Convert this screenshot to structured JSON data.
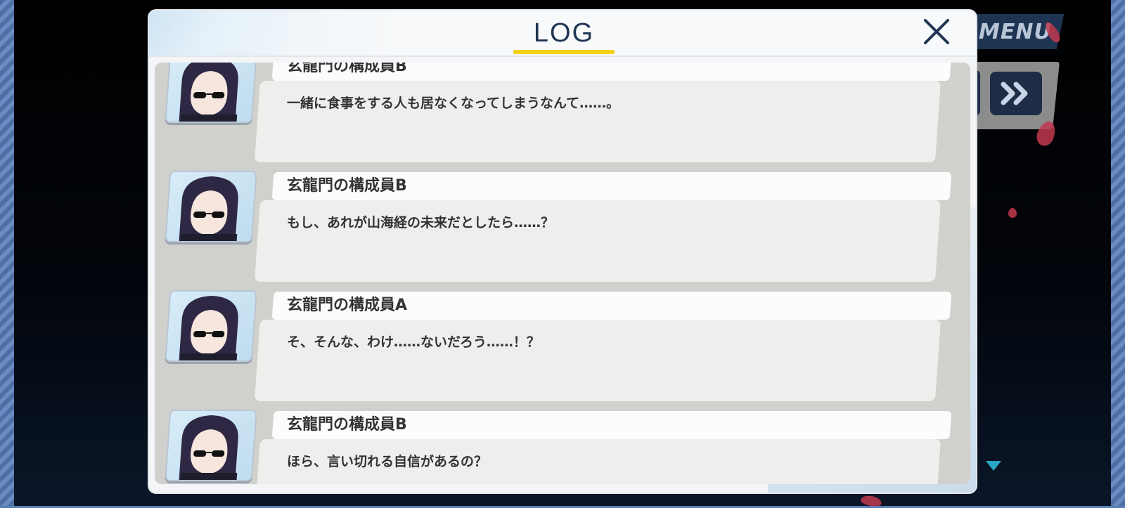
{
  "dialog": {
    "title": "LOG",
    "close_label": "×"
  },
  "hud": {
    "menu_label": "MENU",
    "skip_icon": "fast-forward-icon",
    "scroll_indicator_icon": "down-arrow-icon"
  },
  "colors": {
    "title_text": "#1f3552",
    "title_underline": "#f3d11a",
    "panel_background": "#d0d0cc",
    "message_background": "#eeeeec",
    "name_plate_background": "#fcfcfc",
    "petal": "#c0394f",
    "scroll_indicator": "#2aa7c6"
  },
  "entries": [
    {
      "speaker": "玄龍門の構成員B",
      "message": "一緒に食事をする人も居なくなってしまうなんて……。"
    },
    {
      "speaker": "玄龍門の構成員B",
      "message": "もし、あれが山海経の未来だとしたら……？"
    },
    {
      "speaker": "玄龍門の構成員A",
      "message": "そ、そんな、わけ……ないだろう……！？"
    },
    {
      "speaker": "玄龍門の構成員B",
      "message": "ほら、言い切れる自信があるの？"
    }
  ]
}
